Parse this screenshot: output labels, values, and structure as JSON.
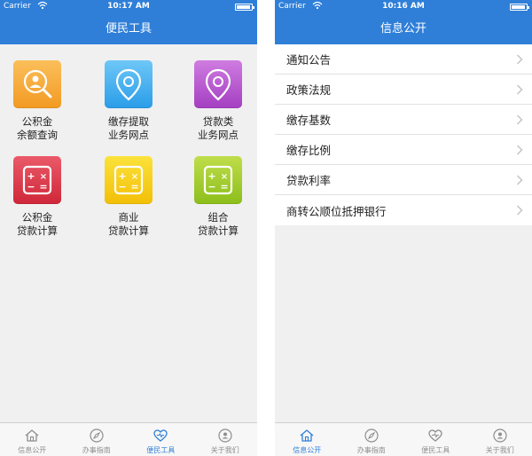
{
  "left": {
    "status": {
      "carrier": "Carrier",
      "time": "10:17 AM"
    },
    "title": "便民工具",
    "tools": [
      {
        "line1": "公积金",
        "line2": "余额查询",
        "icon": "search-person-icon",
        "color": "orange"
      },
      {
        "line1": "缴存提取",
        "line2": "业务网点",
        "icon": "location-pin-icon",
        "color": "blue"
      },
      {
        "line1": "贷款类",
        "line2": "业务网点",
        "icon": "location-pin-icon",
        "color": "purple"
      },
      {
        "line1": "公积金",
        "line2": "贷款计算",
        "icon": "calculator-icon",
        "color": "red"
      },
      {
        "line1": "商业",
        "line2": "贷款计算",
        "icon": "calculator-icon",
        "color": "yellow"
      },
      {
        "line1": "组合",
        "line2": "贷款计算",
        "icon": "calculator-icon",
        "color": "green"
      }
    ],
    "tabs": [
      {
        "label": "信息公开",
        "icon": "home-icon"
      },
      {
        "label": "办事指南",
        "icon": "compass-icon"
      },
      {
        "label": "便民工具",
        "icon": "heart-icon",
        "active": true
      },
      {
        "label": "关于我们",
        "icon": "person-circle-icon"
      }
    ]
  },
  "right": {
    "status": {
      "carrier": "Carrier",
      "time": "10:16 AM"
    },
    "title": "信息公开",
    "items": [
      {
        "label": "通知公告"
      },
      {
        "label": "政策法规"
      },
      {
        "label": "缴存基数"
      },
      {
        "label": "缴存比例"
      },
      {
        "label": "贷款利率"
      },
      {
        "label": "商转公顺位抵押银行"
      }
    ],
    "tabs": [
      {
        "label": "信息公开",
        "icon": "home-icon",
        "active": true
      },
      {
        "label": "办事指南",
        "icon": "compass-icon"
      },
      {
        "label": "便民工具",
        "icon": "heart-icon"
      },
      {
        "label": "关于我们",
        "icon": "person-circle-icon"
      }
    ]
  },
  "colors": {
    "accent": "#2f7fd9",
    "inactive_tab": "#8e8e8e"
  }
}
